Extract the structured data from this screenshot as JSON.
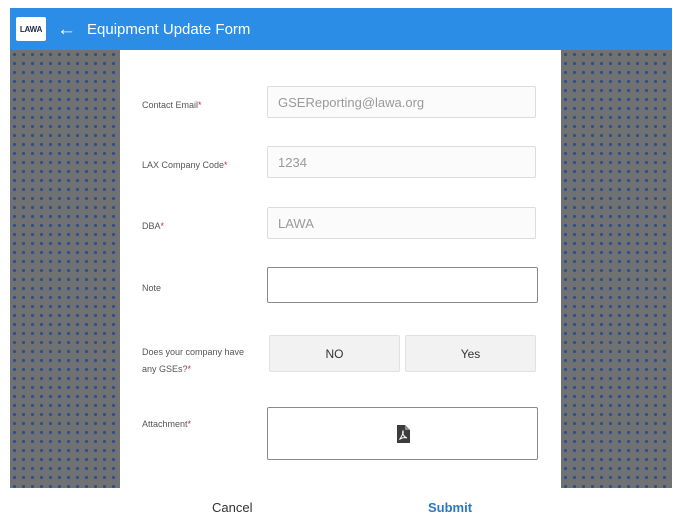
{
  "header": {
    "logo_text": "LAWA",
    "title": "Equipment Update Form"
  },
  "form": {
    "contact_email": {
      "label": "Contact Email",
      "required": "*",
      "value": "GSEReporting@lawa.org"
    },
    "company_code": {
      "label": "LAX Company Code",
      "required": "*",
      "value": "1234"
    },
    "dba": {
      "label": "DBA",
      "required": "*",
      "value": "LAWA"
    },
    "note": {
      "label": "Note",
      "value": ""
    },
    "gse_question": {
      "label_line1": "Does your company have",
      "label_line2": "any GSEs?",
      "required": "*",
      "no_label": "NO",
      "yes_label": "Yes"
    },
    "attachment": {
      "label": "Attachment",
      "required": "*",
      "icon": "pdf-icon"
    }
  },
  "footer": {
    "cancel_label": "Cancel",
    "submit_label": "Submit"
  },
  "colors": {
    "header_bg": "#2b8de6",
    "required_mark": "#d0215e",
    "submit_text": "#2b78c5"
  }
}
